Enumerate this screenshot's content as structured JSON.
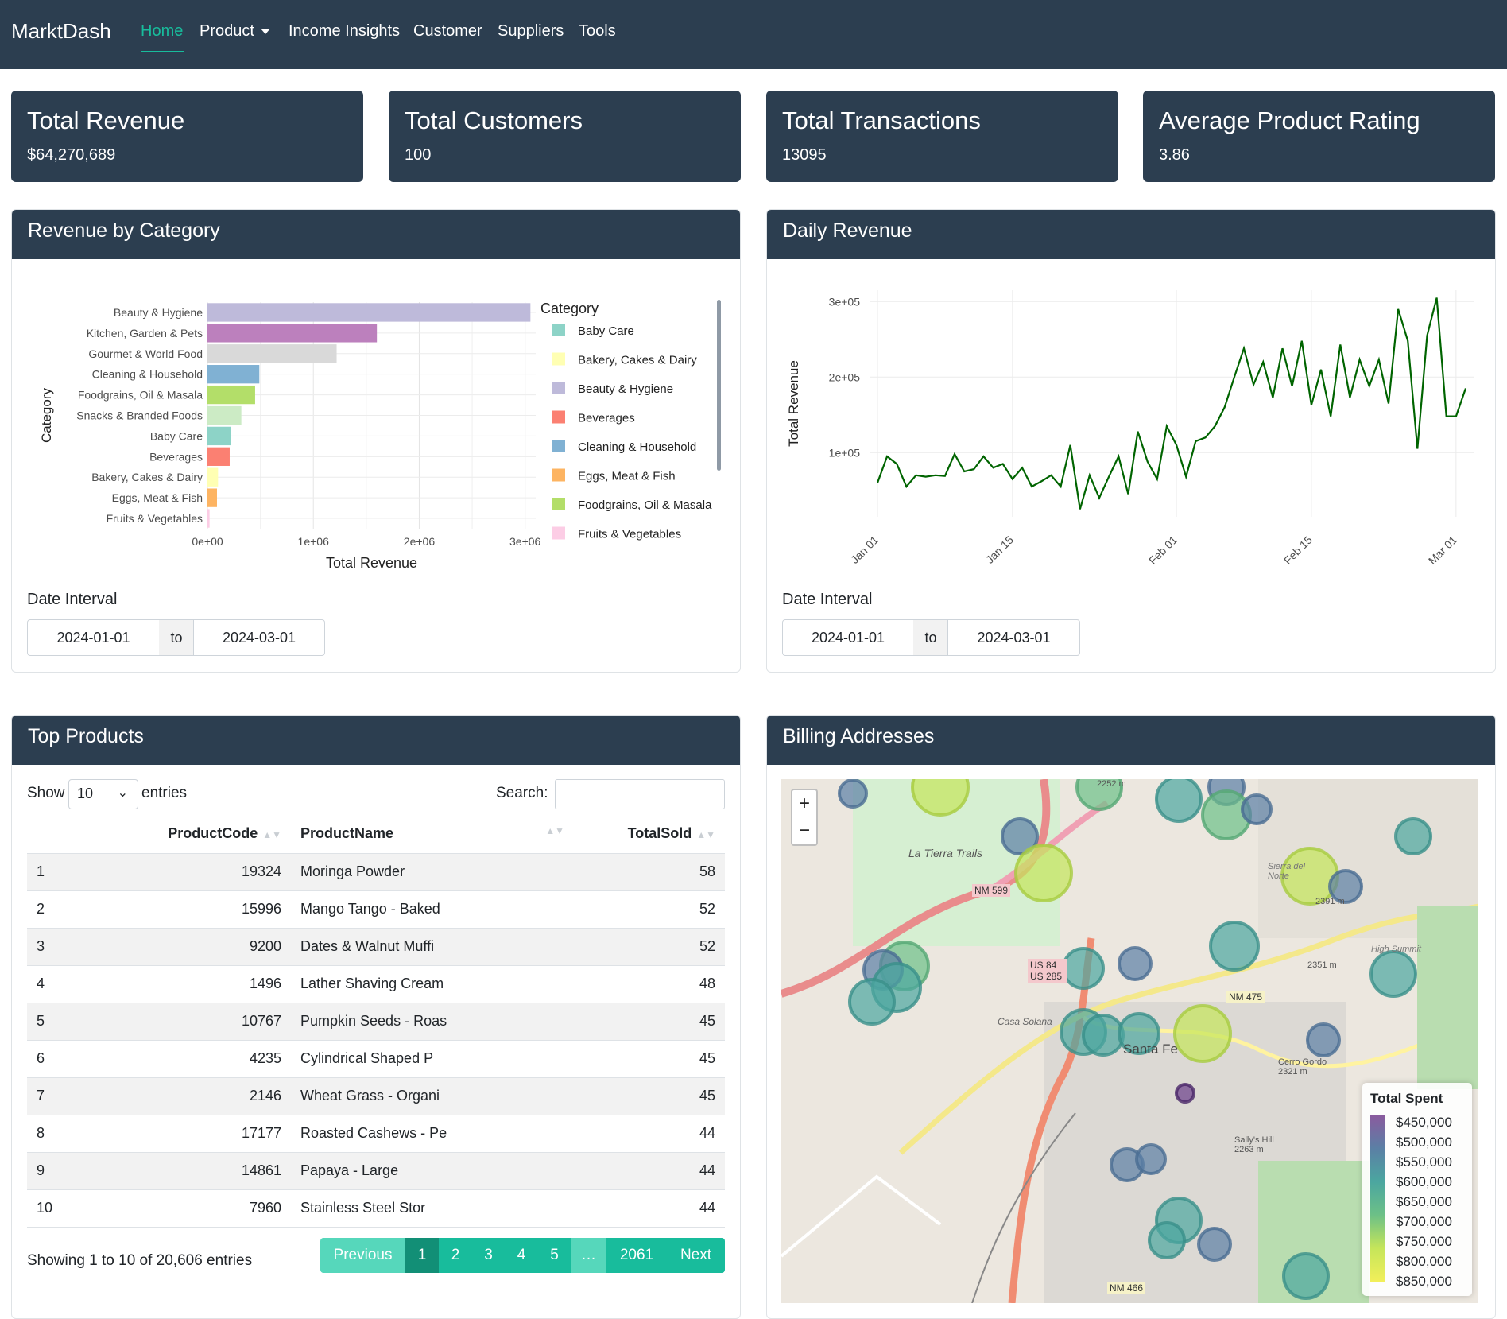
{
  "nav": {
    "brand": "MarktDash",
    "items": [
      "Home",
      "Product",
      "Income Insights",
      "Customer",
      "Suppliers",
      "Tools"
    ]
  },
  "stats": [
    {
      "title": "Total Revenue",
      "value": "$64,270,689"
    },
    {
      "title": "Total Customers",
      "value": "100"
    },
    {
      "title": "Total Transactions",
      "value": "13095"
    },
    {
      "title": "Average Product Rating",
      "value": "3.86"
    }
  ],
  "revenue_card": {
    "title": "Revenue by Category",
    "date_label": "Date Interval",
    "date_from": "2024-01-01",
    "date_sep": "to",
    "date_to": "2024-03-01"
  },
  "daily_card": {
    "title": "Daily Revenue",
    "date_label": "Date Interval",
    "date_from": "2024-01-01",
    "date_sep": "to",
    "date_to": "2024-03-01"
  },
  "chart_data": [
    {
      "type": "bar",
      "orientation": "horizontal",
      "xlabel": "Total Revenue",
      "ylabel": "Category",
      "xlim": [
        0,
        3100000
      ],
      "xticks": [
        "0e+00",
        "1e+06",
        "2e+06",
        "3e+06"
      ],
      "categories": [
        "Beauty & Hygiene",
        "Kitchen, Garden & Pets",
        "Gourmet & World Food",
        "Cleaning & Household",
        "Foodgrains, Oil & Masala",
        "Snacks & Branded Foods",
        "Baby Care",
        "Beverages",
        "Bakery, Cakes & Dairy",
        "Eggs, Meat & Fish",
        "Fruits & Vegetables"
      ],
      "values": [
        3050000,
        1600000,
        1220000,
        490000,
        450000,
        320000,
        220000,
        210000,
        100000,
        90000,
        20000
      ],
      "colors": [
        "#bebada",
        "#bc80bd",
        "#d9d9d9",
        "#80b1d3",
        "#b3de69",
        "#ccebc5",
        "#8dd3c7",
        "#fb8072",
        "#ffffb3",
        "#fdb462",
        "#fccde5"
      ],
      "legend": {
        "title": "Category",
        "position": "right",
        "items": [
          {
            "label": "Baby Care",
            "color": "#8dd3c7"
          },
          {
            "label": "Bakery, Cakes & Dairy",
            "color": "#ffffb3"
          },
          {
            "label": "Beauty & Hygiene",
            "color": "#bebada"
          },
          {
            "label": "Beverages",
            "color": "#fb8072"
          },
          {
            "label": "Cleaning & Household",
            "color": "#80b1d3"
          },
          {
            "label": "Eggs, Meat & Fish",
            "color": "#fdb462"
          },
          {
            "label": "Foodgrains, Oil & Masala",
            "color": "#b3de69"
          },
          {
            "label": "Fruits & Vegetables",
            "color": "#fccde5"
          }
        ]
      },
      "grid": true
    },
    {
      "type": "line",
      "xlabel": "Date",
      "ylabel": "Total Revenue",
      "xticks": [
        "Jan 01",
        "Jan 15",
        "Feb 01",
        "Feb 15",
        "Mar 01"
      ],
      "yticks": [
        "1e+05",
        "2e+05",
        "3e+05"
      ],
      "ylim": [
        15000,
        315000
      ],
      "x_start": "2024-01-01",
      "x_end": "2024-03-01",
      "color": "#006400",
      "values": [
        60000,
        95000,
        85000,
        55000,
        70000,
        68000,
        70000,
        69000,
        98000,
        75000,
        78000,
        95000,
        80000,
        85000,
        65000,
        80000,
        55000,
        62000,
        70000,
        55000,
        110000,
        25000,
        70000,
        40000,
        68000,
        95000,
        45000,
        128000,
        88000,
        65000,
        135000,
        110000,
        68000,
        115000,
        120000,
        135000,
        160000,
        200000,
        238000,
        190000,
        220000,
        173000,
        238000,
        188000,
        248000,
        163000,
        210000,
        148000,
        243000,
        173000,
        223000,
        188000,
        223000,
        165000,
        290000,
        248000,
        105000,
        255000,
        305000,
        148000,
        148000,
        185000
      ]
    }
  ],
  "top_products": {
    "title": "Top Products",
    "show_label": "Show",
    "entries_value": "10",
    "entries_label": "entries",
    "search_label": "Search:",
    "search_value": "",
    "columns": [
      "",
      "ProductCode",
      "ProductName",
      "TotalSold"
    ],
    "rows": [
      [
        "1",
        "19324",
        "Moringa Powder",
        "58"
      ],
      [
        "2",
        "15996",
        "Mango Tango - Baked",
        "52"
      ],
      [
        "3",
        "9200",
        "Dates & Walnut Muffi",
        "52"
      ],
      [
        "4",
        "1496",
        "Lather Shaving Cream",
        "48"
      ],
      [
        "5",
        "10767",
        "Pumpkin Seeds - Roas",
        "45"
      ],
      [
        "6",
        "4235",
        "Cylindrical Shaped P",
        "45"
      ],
      [
        "7",
        "2146",
        "Wheat Grass - Organi",
        "45"
      ],
      [
        "8",
        "17177",
        "Roasted Cashews - Pe",
        "44"
      ],
      [
        "9",
        "14861",
        "Papaya - Large",
        "44"
      ],
      [
        "10",
        "7960",
        "Stainless Steel Stor",
        "44"
      ]
    ],
    "info": "Showing 1 to 10 of 20,606 entries",
    "pager": [
      "Previous",
      "1",
      "2",
      "3",
      "4",
      "5",
      "…",
      "2061",
      "Next"
    ]
  },
  "billing": {
    "title": "Billing Addresses",
    "zoom_in": "+",
    "zoom_out": "−",
    "map_labels": [
      "La Tierra Trails",
      "NM 599",
      "US 84 US 285",
      "NM 475",
      "Casa Solana",
      "Santa Fe",
      "Sierra del Norte",
      "High Summit",
      "Cerro Gordo 2321 m",
      "Sally's Hill 2263 m",
      "NM 466",
      "2351 m",
      "2252 m",
      "2391 m"
    ],
    "legend_title": "Total Spent",
    "legend_values": [
      "$450,000",
      "$500,000",
      "$550,000",
      "$600,000",
      "$650,000",
      "$700,000",
      "$750,000",
      "$800,000",
      "$850,000"
    ]
  },
  "colors": {
    "navbar": "#2c3e50",
    "accent": "#18bc9c",
    "line": "#006400"
  }
}
